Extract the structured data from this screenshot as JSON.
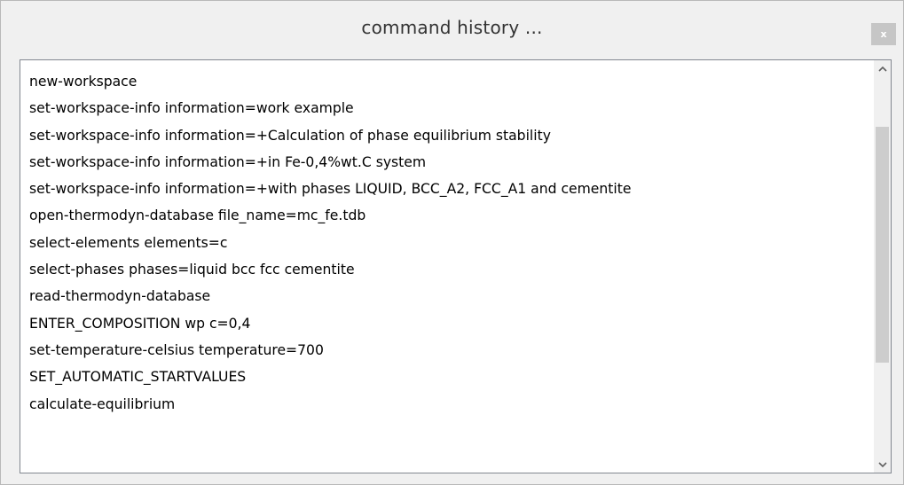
{
  "window": {
    "title": "command history ...",
    "close_label": "x"
  },
  "history": [
    "new-workspace",
    "set-workspace-info information=work example",
    "set-workspace-info information=+Calculation of phase equilibrium stability",
    "set-workspace-info information=+in Fe-0,4%wt.C system",
    "set-workspace-info information=+with phases LIQUID, BCC_A2, FCC_A1 and cementite",
    "open-thermodyn-database file_name=mc_fe.tdb",
    "select-elements elements=c",
    "select-phases phases=liquid bcc fcc cementite",
    "read-thermodyn-database",
    "ENTER_COMPOSITION wp c=0,4",
    "set-temperature-celsius temperature=700",
    "SET_AUTOMATIC_STARTVALUES",
    "calculate-equilibrium"
  ],
  "scrollbar": {
    "up_icon": "chevron-up-icon",
    "down_icon": "chevron-down-icon",
    "position_fraction": 0.35,
    "visible_fraction": 0.62
  }
}
